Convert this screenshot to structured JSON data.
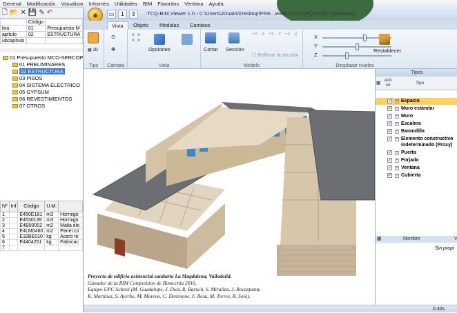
{
  "bg_app": {
    "menu": [
      "General",
      "Modificación",
      "Visualizar",
      "Informes",
      "Utilidades",
      "BIM",
      "Favoritos",
      "Ventana",
      "Ayuda"
    ],
    "budget_rows": [
      [
        "",
        "Código",
        ""
      ],
      [
        "bra",
        "01",
        "Presupuesto M"
      ],
      [
        "apítulo",
        "02",
        "ESTRUCTURA"
      ],
      [
        "ubcapítulo",
        "",
        ""
      ]
    ],
    "tree": [
      {
        "label": "01 Presupuesto MCO-SERCOP-00",
        "level": 0,
        "selected": false
      },
      {
        "label": "01  PRELIMINARES",
        "level": 1,
        "selected": false
      },
      {
        "label": "02  ESTRUCTURA",
        "level": 1,
        "selected": true
      },
      {
        "label": "03  PISOS",
        "level": 1,
        "selected": false
      },
      {
        "label": "04  SISTEMA ELECTRICO",
        "level": 1,
        "selected": false
      },
      {
        "label": "05  GYPSUM",
        "level": 1,
        "selected": false
      },
      {
        "label": "06  REVESTIMIENTOS",
        "level": 1,
        "selected": false
      },
      {
        "label": "07  OTROS",
        "level": 1,
        "selected": false
      }
    ],
    "grid_headers": [
      "Nº",
      "Inf",
      "Código",
      "U.M.",
      ""
    ],
    "grid_rows": [
      [
        "1",
        "",
        "E450E181",
        "m3",
        "Hormigó"
      ],
      [
        "2",
        "",
        "E4530139",
        "m3",
        "Hormigó"
      ],
      [
        "3",
        "",
        "E4B00002",
        "m2",
        "Malla ele"
      ],
      [
        "4",
        "",
        "E4LM0460",
        "m2",
        "Panel co"
      ],
      [
        "5",
        "",
        "E32BE010",
        "kg",
        "Acero re"
      ],
      [
        "6",
        "",
        "E4404251",
        "kg",
        "Fabricac"
      ],
      [
        "7",
        "",
        "",
        "",
        ""
      ]
    ]
  },
  "viewer": {
    "title": "TCQ-BIM Viewer 1.0 - C:\\Users\\JDuatis\\Desktop\\PRE...iewer 2017\\ARQUITECTURA\\ARQ...",
    "qat_value": "1",
    "tabs": [
      "Vista",
      "Objeto",
      "Medidas",
      "Cambios"
    ],
    "active_tab": "Vista",
    "ribbon": {
      "tipo_label": "Tipo",
      "camara_label": "Cámara",
      "vista_label": "Vista",
      "modelo_label": "Modelo",
      "desplazar_label": "Desplazar niveles",
      "opciones": "Opciones",
      "cortar": "Cortar",
      "seccion": "Sección",
      "rellenar": "Rellenar la sección",
      "axes": [
        "X",
        "Y",
        "Z"
      ],
      "restablecer": "Restablecer",
      "clip_buttons": [
        "+X",
        "-X",
        "+Y",
        "-Y",
        "+Z",
        "-Z"
      ],
      "sliders": [
        0.62,
        0.5,
        0.35
      ]
    },
    "caption": {
      "line1": "Proyecto de edificio asistencial sanitario La Magdalena, Valladolid.",
      "line2": "Ganador de la BIM Competition de Bimtecnia 2016.",
      "line3": "Equipo UPC School (M. Guadalupe, J. Diez, R. Baruch, S. Mirallas, J. Rocaspana,",
      "line4": "K. Martínez, S. Ayerbe, M. Moreno, C. Desimone, F. Resa, M. Torres, R. Solé)."
    },
    "types_panel": {
      "title": "Tipos",
      "col_activo": "Acti vo",
      "col_tipo": "Tipo",
      "rows": [
        {
          "label": "Espacio",
          "checked": true,
          "highlight": true
        },
        {
          "label": "Muro estándar",
          "checked": true,
          "highlight": false
        },
        {
          "label": "Muro",
          "checked": true,
          "highlight": false
        },
        {
          "label": "Escalera",
          "checked": true,
          "highlight": false
        },
        {
          "label": "Barandilla",
          "checked": true,
          "highlight": false
        },
        {
          "label": "Elemento constructivo indeterminado (Proxy)",
          "checked": true,
          "highlight": false
        },
        {
          "label": "Puerta",
          "checked": true,
          "highlight": false
        },
        {
          "label": "Forjado",
          "checked": true,
          "highlight": false
        },
        {
          "label": "Ventana",
          "checked": true,
          "highlight": false
        },
        {
          "label": "Cubierta",
          "checked": true,
          "highlight": false
        }
      ]
    },
    "props_panel": {
      "col_nombre": "Nombre",
      "col_value": "V",
      "empty_text": "Sin propi"
    },
    "status": "0.32s"
  },
  "colors": {
    "accent": "#3d7bd6",
    "highlight": "#ffd15c",
    "ribbon": "#dfe8f3",
    "roof": "#6b6e72",
    "wall": "#c4b29a",
    "glass": "#3f87c9"
  }
}
